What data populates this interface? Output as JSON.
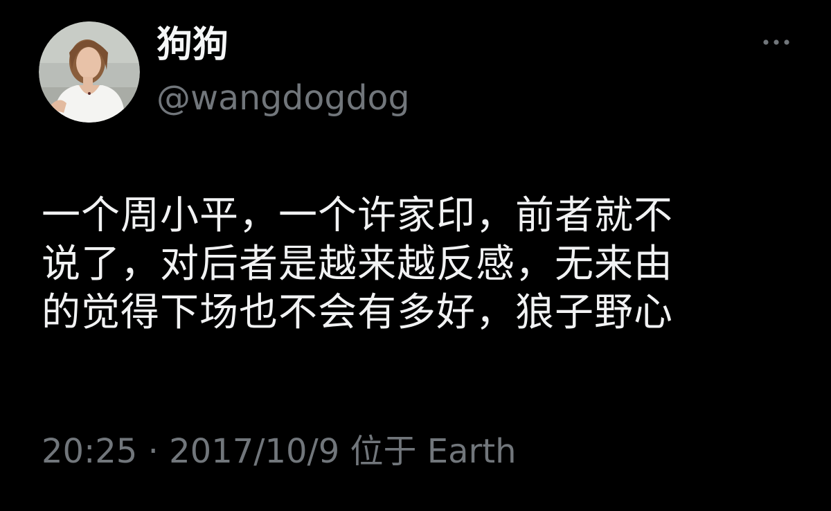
{
  "colors": {
    "background": "#000000",
    "primary_text": "#e7e9ea",
    "secondary_text": "#71767b"
  },
  "author": {
    "display_name": "狗狗",
    "handle": "@wangdogdog",
    "avatar_icon": "avatar-photo"
  },
  "actions": {
    "more_icon": "ellipsis-horizontal-icon"
  },
  "tweet": {
    "lines": [
      "一个周小平，一个许家印，前者就不",
      "说了，对后者是越来越反感，无来由",
      "的觉得下场也不会有多好，狼子野心"
    ]
  },
  "meta": {
    "time": "20:25",
    "separator": " · ",
    "date": "2017/10/9",
    "location_prefix": " 位于 ",
    "location": "Earth"
  }
}
